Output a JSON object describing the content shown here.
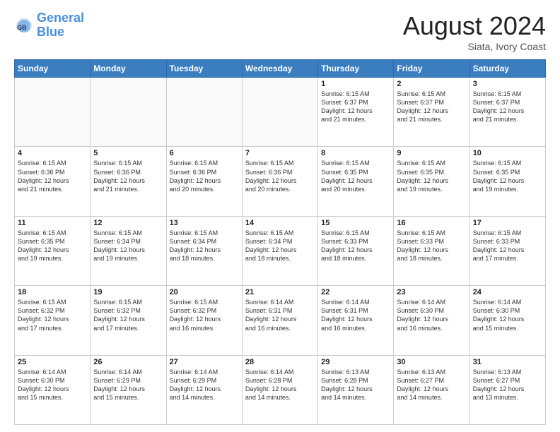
{
  "logo": {
    "line1": "General",
    "line2": "Blue"
  },
  "title": "August 2024",
  "subtitle": "Siata, Ivory Coast",
  "weekdays": [
    "Sunday",
    "Monday",
    "Tuesday",
    "Wednesday",
    "Thursday",
    "Friday",
    "Saturday"
  ],
  "weeks": [
    [
      {
        "day": "",
        "info": ""
      },
      {
        "day": "",
        "info": ""
      },
      {
        "day": "",
        "info": ""
      },
      {
        "day": "",
        "info": ""
      },
      {
        "day": "1",
        "info": "Sunrise: 6:15 AM\nSunset: 6:37 PM\nDaylight: 12 hours\nand 21 minutes."
      },
      {
        "day": "2",
        "info": "Sunrise: 6:15 AM\nSunset: 6:37 PM\nDaylight: 12 hours\nand 21 minutes."
      },
      {
        "day": "3",
        "info": "Sunrise: 6:15 AM\nSunset: 6:37 PM\nDaylight: 12 hours\nand 21 minutes."
      }
    ],
    [
      {
        "day": "4",
        "info": "Sunrise: 6:15 AM\nSunset: 6:36 PM\nDaylight: 12 hours\nand 21 minutes."
      },
      {
        "day": "5",
        "info": "Sunrise: 6:15 AM\nSunset: 6:36 PM\nDaylight: 12 hours\nand 21 minutes."
      },
      {
        "day": "6",
        "info": "Sunrise: 6:15 AM\nSunset: 6:36 PM\nDaylight: 12 hours\nand 20 minutes."
      },
      {
        "day": "7",
        "info": "Sunrise: 6:15 AM\nSunset: 6:36 PM\nDaylight: 12 hours\nand 20 minutes."
      },
      {
        "day": "8",
        "info": "Sunrise: 6:15 AM\nSunset: 6:35 PM\nDaylight: 12 hours\nand 20 minutes."
      },
      {
        "day": "9",
        "info": "Sunrise: 6:15 AM\nSunset: 6:35 PM\nDaylight: 12 hours\nand 19 minutes."
      },
      {
        "day": "10",
        "info": "Sunrise: 6:15 AM\nSunset: 6:35 PM\nDaylight: 12 hours\nand 19 minutes."
      }
    ],
    [
      {
        "day": "11",
        "info": "Sunrise: 6:15 AM\nSunset: 6:35 PM\nDaylight: 12 hours\nand 19 minutes."
      },
      {
        "day": "12",
        "info": "Sunrise: 6:15 AM\nSunset: 6:34 PM\nDaylight: 12 hours\nand 19 minutes."
      },
      {
        "day": "13",
        "info": "Sunrise: 6:15 AM\nSunset: 6:34 PM\nDaylight: 12 hours\nand 18 minutes."
      },
      {
        "day": "14",
        "info": "Sunrise: 6:15 AM\nSunset: 6:34 PM\nDaylight: 12 hours\nand 18 minutes."
      },
      {
        "day": "15",
        "info": "Sunrise: 6:15 AM\nSunset: 6:33 PM\nDaylight: 12 hours\nand 18 minutes."
      },
      {
        "day": "16",
        "info": "Sunrise: 6:15 AM\nSunset: 6:33 PM\nDaylight: 12 hours\nand 18 minutes."
      },
      {
        "day": "17",
        "info": "Sunrise: 6:15 AM\nSunset: 6:33 PM\nDaylight: 12 hours\nand 17 minutes."
      }
    ],
    [
      {
        "day": "18",
        "info": "Sunrise: 6:15 AM\nSunset: 6:32 PM\nDaylight: 12 hours\nand 17 minutes."
      },
      {
        "day": "19",
        "info": "Sunrise: 6:15 AM\nSunset: 6:32 PM\nDaylight: 12 hours\nand 17 minutes."
      },
      {
        "day": "20",
        "info": "Sunrise: 6:15 AM\nSunset: 6:32 PM\nDaylight: 12 hours\nand 16 minutes."
      },
      {
        "day": "21",
        "info": "Sunrise: 6:14 AM\nSunset: 6:31 PM\nDaylight: 12 hours\nand 16 minutes."
      },
      {
        "day": "22",
        "info": "Sunrise: 6:14 AM\nSunset: 6:31 PM\nDaylight: 12 hours\nand 16 minutes."
      },
      {
        "day": "23",
        "info": "Sunrise: 6:14 AM\nSunset: 6:30 PM\nDaylight: 12 hours\nand 16 minutes."
      },
      {
        "day": "24",
        "info": "Sunrise: 6:14 AM\nSunset: 6:30 PM\nDaylight: 12 hours\nand 15 minutes."
      }
    ],
    [
      {
        "day": "25",
        "info": "Sunrise: 6:14 AM\nSunset: 6:30 PM\nDaylight: 12 hours\nand 15 minutes."
      },
      {
        "day": "26",
        "info": "Sunrise: 6:14 AM\nSunset: 6:29 PM\nDaylight: 12 hours\nand 15 minutes."
      },
      {
        "day": "27",
        "info": "Sunrise: 6:14 AM\nSunset: 6:29 PM\nDaylight: 12 hours\nand 14 minutes."
      },
      {
        "day": "28",
        "info": "Sunrise: 6:14 AM\nSunset: 6:28 PM\nDaylight: 12 hours\nand 14 minutes."
      },
      {
        "day": "29",
        "info": "Sunrise: 6:13 AM\nSunset: 6:28 PM\nDaylight: 12 hours\nand 14 minutes."
      },
      {
        "day": "30",
        "info": "Sunrise: 6:13 AM\nSunset: 6:27 PM\nDaylight: 12 hours\nand 14 minutes."
      },
      {
        "day": "31",
        "info": "Sunrise: 6:13 AM\nSunset: 6:27 PM\nDaylight: 12 hours\nand 13 minutes."
      }
    ]
  ]
}
